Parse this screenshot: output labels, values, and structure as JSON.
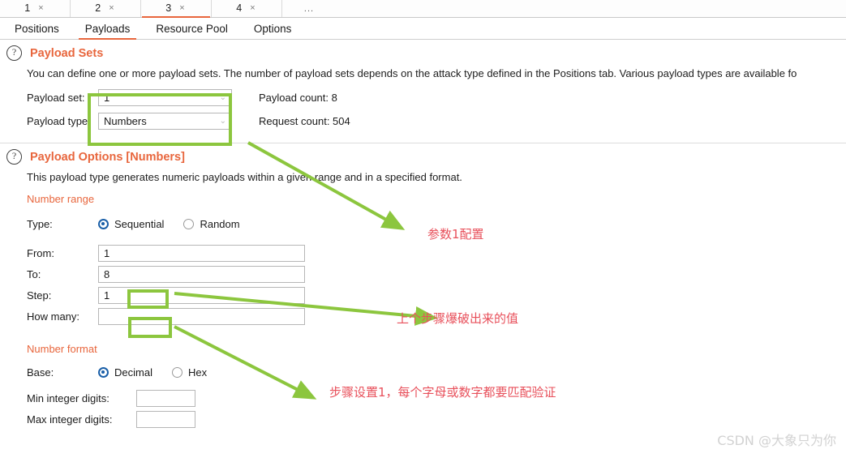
{
  "attack_tabs": [
    {
      "label": "1",
      "close": "×",
      "active": false
    },
    {
      "label": "2",
      "close": "×",
      "active": false
    },
    {
      "label": "3",
      "close": "×",
      "active": true
    },
    {
      "label": "4",
      "close": "×",
      "active": false
    }
  ],
  "attack_tabs_more": "...",
  "section_tabs": [
    {
      "label": "Positions",
      "active": false
    },
    {
      "label": "Payloads",
      "active": true
    },
    {
      "label": "Resource Pool",
      "active": false
    },
    {
      "label": "Options",
      "active": false
    }
  ],
  "payload_sets": {
    "help_glyph": "?",
    "title": "Payload Sets",
    "description": "You can define one or more payload sets. The number of payload sets depends on the attack type defined in the Positions tab. Various payload types are available fo",
    "payload_set_label": "Payload set:",
    "payload_set_value": "1",
    "payload_type_label": "Payload type:",
    "payload_type_value": "Numbers",
    "payload_count_label": "Payload count: 8",
    "request_count_label": "Request count: 504",
    "chevron": "⌄"
  },
  "payload_options": {
    "help_glyph": "?",
    "title": "Payload Options [Numbers]",
    "description": "This payload type generates numeric payloads within a given range and in a specified format.",
    "number_range_title": "Number range",
    "type_label": "Type:",
    "type_options": [
      {
        "label": "Sequential",
        "checked": true
      },
      {
        "label": "Random",
        "checked": false
      }
    ],
    "from_label": "From:",
    "from_value": "1",
    "to_label": "To:",
    "to_value": "8",
    "step_label": "Step:",
    "step_value": "1",
    "how_many_label": "How many:",
    "how_many_value": "",
    "number_format_title": "Number format",
    "base_label": "Base:",
    "base_options": [
      {
        "label": "Decimal",
        "checked": true
      },
      {
        "label": "Hex",
        "checked": false
      }
    ],
    "min_digits_label": "Min integer digits:",
    "min_digits_value": "",
    "max_digits_label": "Max integer digits:",
    "max_digits_value": ""
  },
  "annotations": {
    "highlight_color": "#8cc63e",
    "text_color": "#e8505b",
    "note_1": "参数1配置",
    "note_2": "上个步骤爆破出来的值",
    "note_3": "步骤设置1，每个字母或数字都要匹配验证"
  },
  "watermark": "CSDN @大象只为你"
}
